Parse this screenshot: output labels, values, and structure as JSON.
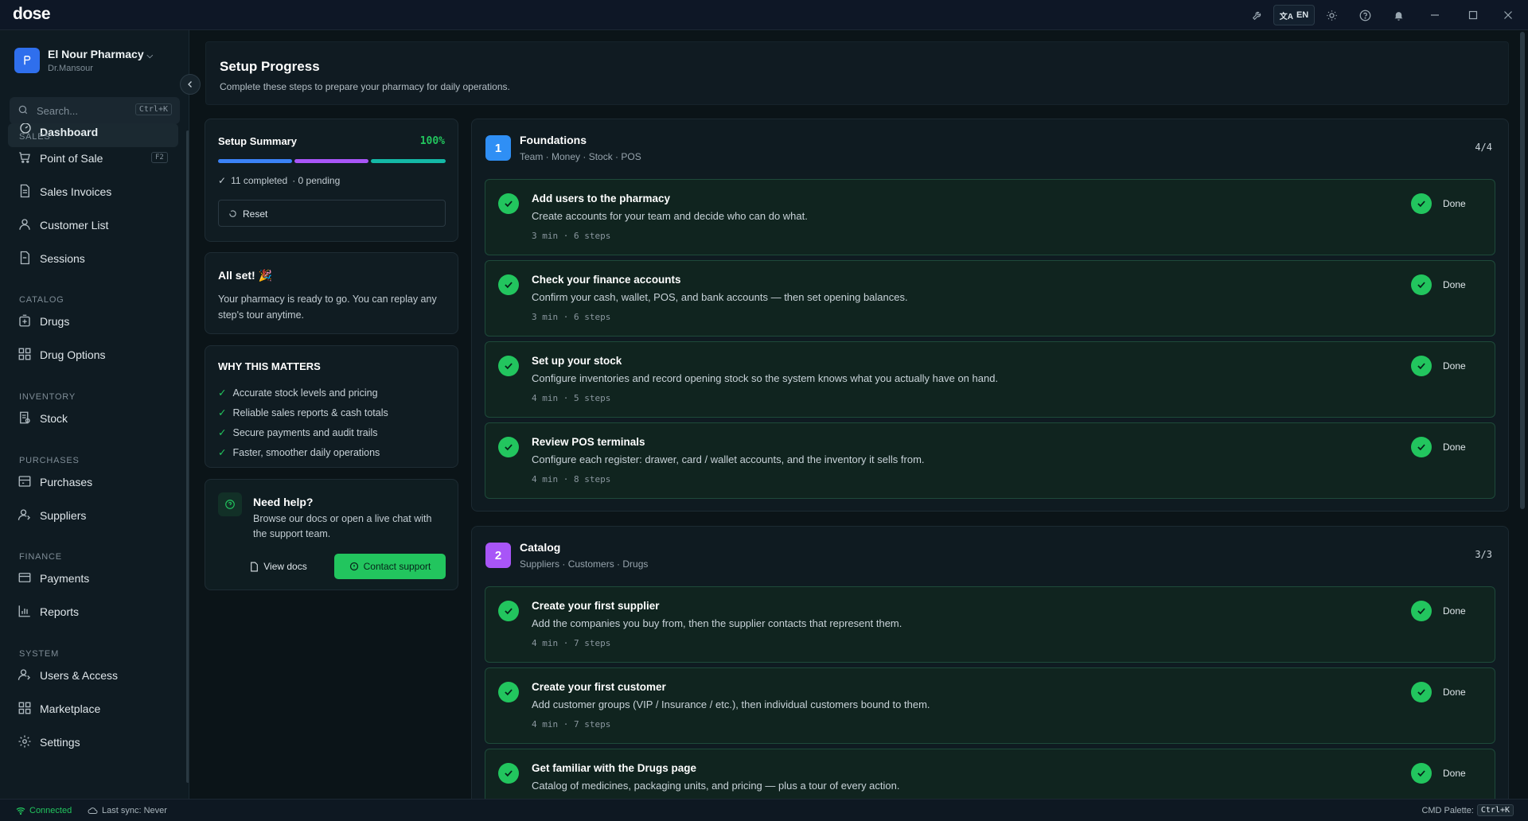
{
  "app": {
    "logo": "dose",
    "language": "EN"
  },
  "titlebar": {
    "icons": [
      "wrench-icon",
      "translate-icon",
      "sun-icon",
      "help-circle-icon",
      "bell-icon",
      "minimize-icon",
      "maximize-icon",
      "close-icon"
    ]
  },
  "org": {
    "name": "El Nour Pharmacy",
    "user": "Dr.Mansour"
  },
  "search": {
    "placeholder": "Search...",
    "shortcut": "Ctrl+K"
  },
  "sidebar": {
    "active": "Dashboard",
    "sections": [
      {
        "label": "SALES",
        "items": [
          {
            "label": "Point of Sale",
            "key": "F2"
          },
          {
            "label": "Sales Invoices"
          },
          {
            "label": "Customer List"
          },
          {
            "label": "Sessions"
          }
        ]
      },
      {
        "label": "CATALOG",
        "items": [
          {
            "label": "Drugs"
          },
          {
            "label": "Drug Options"
          }
        ]
      },
      {
        "label": "INVENTORY",
        "items": [
          {
            "label": "Stock"
          }
        ]
      },
      {
        "label": "PURCHASES",
        "items": [
          {
            "label": "Purchases"
          },
          {
            "label": "Suppliers"
          }
        ]
      },
      {
        "label": "FINANCE",
        "items": [
          {
            "label": "Payments"
          },
          {
            "label": "Reports"
          }
        ]
      },
      {
        "label": "SYSTEM",
        "items": [
          {
            "label": "Users & Access"
          },
          {
            "label": "Marketplace"
          },
          {
            "label": "Settings"
          }
        ]
      }
    ]
  },
  "page": {
    "title": "Setup Progress",
    "subtitle": "Complete these steps to prepare your pharmacy for daily operations."
  },
  "summary": {
    "title": "Setup Summary",
    "percent": "100%",
    "progress": 1.0,
    "completed": "11 completed",
    "pending": "· 0 pending",
    "reset": "Reset",
    "bar_colors": [
      "#3b82f6",
      "#a855f7",
      "#14b8a6"
    ]
  },
  "allset": {
    "title": "All set! 🎉",
    "text": "Your pharmacy is ready to go. You can replay any step's tour anytime."
  },
  "why": {
    "title": "WHY THIS MATTERS",
    "items": [
      "Accurate stock levels and pricing",
      "Reliable sales reports & cash totals",
      "Secure payments and audit trails",
      "Faster, smoother daily operations"
    ]
  },
  "help": {
    "title": "Need help?",
    "text": "Browse our docs or open a live chat with the support team.",
    "docs": "View docs",
    "support": "Contact support"
  },
  "groups": [
    {
      "num": "1",
      "title": "Foundations",
      "subtitle": "Team · Money · Stock · POS",
      "count": "4/4",
      "color": "#2f8ff5",
      "tasks": [
        {
          "title": "Add users to the pharmacy",
          "desc": "Create accounts for your team and decide who can do what.",
          "meta": "3 min · 6 steps",
          "status": "Done"
        },
        {
          "title": "Check your finance accounts",
          "desc": "Confirm your cash, wallet, POS, and bank accounts — then set opening balances.",
          "meta": "3 min · 6 steps",
          "status": "Done"
        },
        {
          "title": "Set up your stock",
          "desc": "Configure inventories and record opening stock so the system knows what you actually have on hand.",
          "meta": "4 min · 5 steps",
          "status": "Done"
        },
        {
          "title": "Review POS terminals",
          "desc": "Configure each register: drawer, card / wallet accounts, and the inventory it sells from.",
          "meta": "4 min · 8 steps",
          "status": "Done"
        }
      ]
    },
    {
      "num": "2",
      "title": "Catalog",
      "subtitle": "Suppliers · Customers · Drugs",
      "count": "3/3",
      "color": "#a855f7",
      "tasks": [
        {
          "title": "Create your first supplier",
          "desc": "Add the companies you buy from, then the supplier contacts that represent them.",
          "meta": "4 min · 7 steps",
          "status": "Done"
        },
        {
          "title": "Create your first customer",
          "desc": "Add customer groups (VIP / Insurance / etc.), then individual customers bound to them.",
          "meta": "4 min · 7 steps",
          "status": "Done"
        },
        {
          "title": "Get familiar with the Drugs page",
          "desc": "Catalog of medicines, packaging units, and pricing — plus a tour of every action.",
          "meta": "",
          "status": "Done"
        }
      ]
    }
  ],
  "status": {
    "connected": "Connected",
    "sync": "Last sync: Never",
    "cmd": "CMD Palette:",
    "cmd_key": "Ctrl+K"
  }
}
